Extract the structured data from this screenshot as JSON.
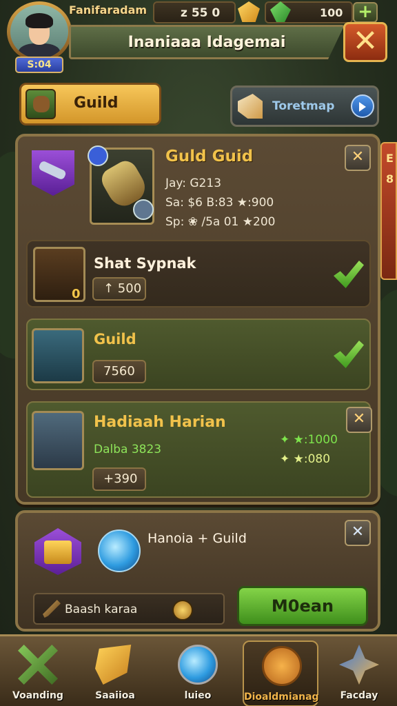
{
  "header": {
    "player_name": "Fanifaradam",
    "level": "S:04",
    "res_energy": "z 55 0",
    "res_gems": "100",
    "title": "Inaniaaa Idagemai"
  },
  "tabs": {
    "guild_label": "Guild",
    "treasure_label": "Toretmap"
  },
  "side_tab": [
    "E",
    "8"
  ],
  "hero": {
    "title": "Guld Guid",
    "line1": "Jay: G213",
    "line2": "Sa: $6 B:83 ★:900",
    "line3": "Sp: ❀ /5a 01 ★200"
  },
  "cards": [
    {
      "title": "Shat Sypnak",
      "value": "↑ 500",
      "badge": "0",
      "status": "check"
    },
    {
      "title": "Guild",
      "value": "7560",
      "status": "check"
    },
    {
      "title": "Hadiaah Harian",
      "subtitle": "Dalba 3823",
      "value": "+390",
      "reward1": "✦ ★:1000",
      "reward2": "✦ ★:080"
    }
  ],
  "bottom_panel": {
    "title": "Hanoia + Guild",
    "search_label": "Baash karaa",
    "button_label": "M0ean"
  },
  "nav": [
    {
      "label": "Voanding"
    },
    {
      "label": "Saaiioa"
    },
    {
      "label": "luieo"
    },
    {
      "label": "Dioaldmianag"
    },
    {
      "label": "Facday"
    }
  ],
  "colors": {
    "gold": "#f1c24b",
    "panel": "#5b4a34",
    "accent_green": "#84d448",
    "accent_red": "#d45a2a"
  }
}
